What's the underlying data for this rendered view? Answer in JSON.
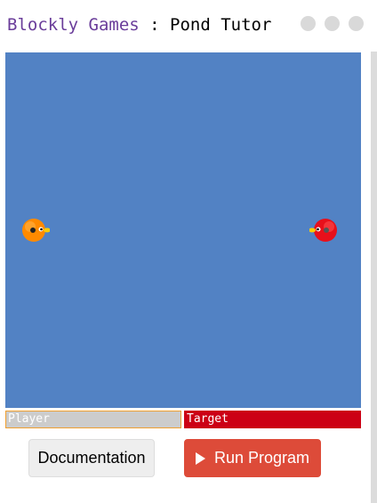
{
  "header": {
    "app_link": "Blockly Games",
    "separator": " : ",
    "level_title": "Pond Tutor",
    "level_dots": [
      "level-1",
      "level-2",
      "level-3"
    ],
    "link_color": "#6a3d9a"
  },
  "pond": {
    "background_color": "#5282c4",
    "ducks": [
      {
        "name": "Player",
        "color": "#ff8a00",
        "facing": "right"
      },
      {
        "name": "Target",
        "color": "#e8101b",
        "facing": "left"
      }
    ]
  },
  "health": {
    "player_label": "Player",
    "target_label": "Target",
    "player_color": "#cccccc",
    "target_color": "#cc0015"
  },
  "controls": {
    "docs_label": "Documentation",
    "run_label": "Run Program",
    "run_color": "#dd4b39",
    "play_icon": "play-icon"
  }
}
